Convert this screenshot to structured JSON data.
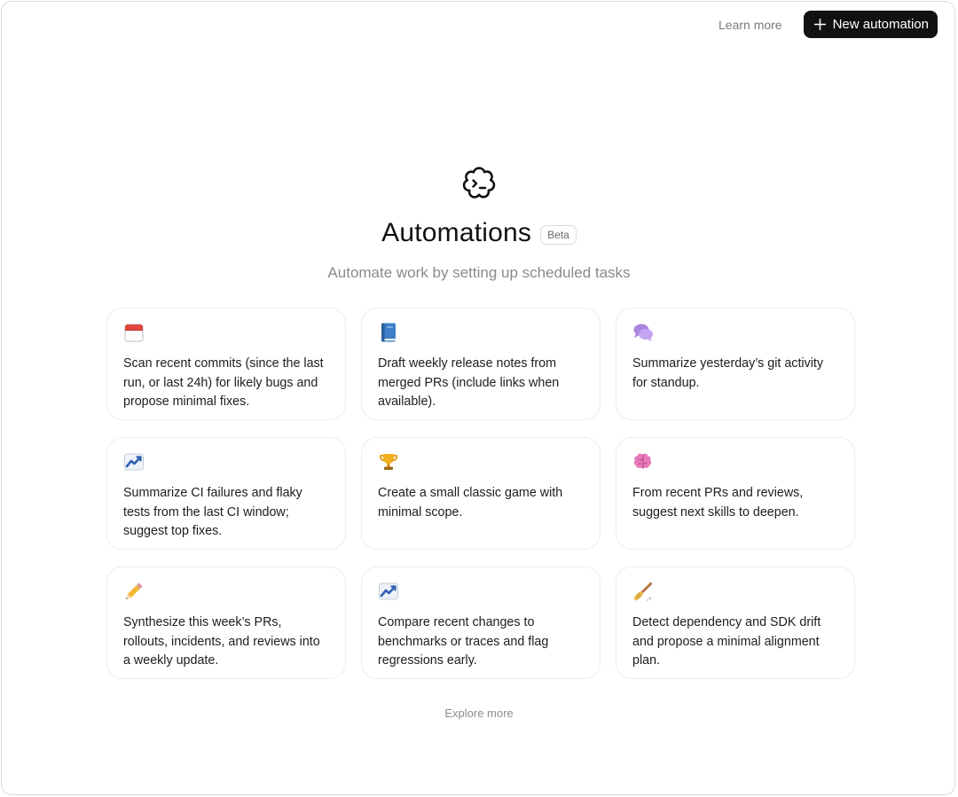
{
  "header": {
    "learn_more": "Learn more",
    "new_automation": "New automation"
  },
  "hero": {
    "title": "Automations",
    "badge": "Beta",
    "subtitle": "Automate work by setting up scheduled tasks"
  },
  "cards": [
    {
      "icon": "calendar-icon",
      "text": "Scan recent commits (since the last run, or last 24h) for likely bugs and propose minimal fixes."
    },
    {
      "icon": "book-icon",
      "text": "Draft weekly release notes from merged PRs (include links when available)."
    },
    {
      "icon": "speech-bubbles-icon",
      "text": "Summarize yesterday’s git activity for standup."
    },
    {
      "icon": "chart-increasing-icon",
      "text": "Summarize CI failures and flaky tests from the last CI window; suggest top fixes."
    },
    {
      "icon": "trophy-icon",
      "text": "Create a small classic game with minimal scope."
    },
    {
      "icon": "brain-icon",
      "text": "From recent PRs and reviews, suggest next skills to deepen."
    },
    {
      "icon": "pencil-icon",
      "text": "Synthesize this week’s PRs, rollouts, incidents, and reviews into a weekly update."
    },
    {
      "icon": "chart-increasing-icon",
      "text": "Compare recent changes to benchmarks or traces and flag regressions early."
    },
    {
      "icon": "broom-icon",
      "text": "Detect dependency and SDK drift and propose a minimal alignment plan."
    }
  ],
  "footer": {
    "explore_more": "Explore more"
  },
  "colors": {
    "primary_button": "#111111",
    "muted_text": "#8a8a8a",
    "card_border": "#ececec"
  }
}
